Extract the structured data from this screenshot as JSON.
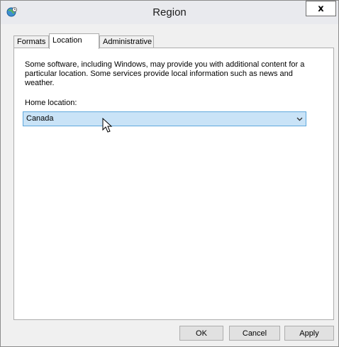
{
  "window": {
    "title": "Region",
    "close_label": "x"
  },
  "tabs": [
    {
      "label": "Formats",
      "active": false
    },
    {
      "label": "Location",
      "active": true
    },
    {
      "label": "Administrative",
      "active": false
    }
  ],
  "location": {
    "description": "Some software, including Windows, may provide you with additional content for a particular location. Some services provide local information such as news and weather.",
    "home_location_label": "Home location:",
    "home_location_value": "Canada"
  },
  "buttons": {
    "ok": "OK",
    "cancel": "Cancel",
    "apply": "Apply"
  },
  "colors": {
    "select_highlight": "#c9e3f7",
    "select_border": "#5fa8dc",
    "window_bg": "#f0f0f0"
  }
}
